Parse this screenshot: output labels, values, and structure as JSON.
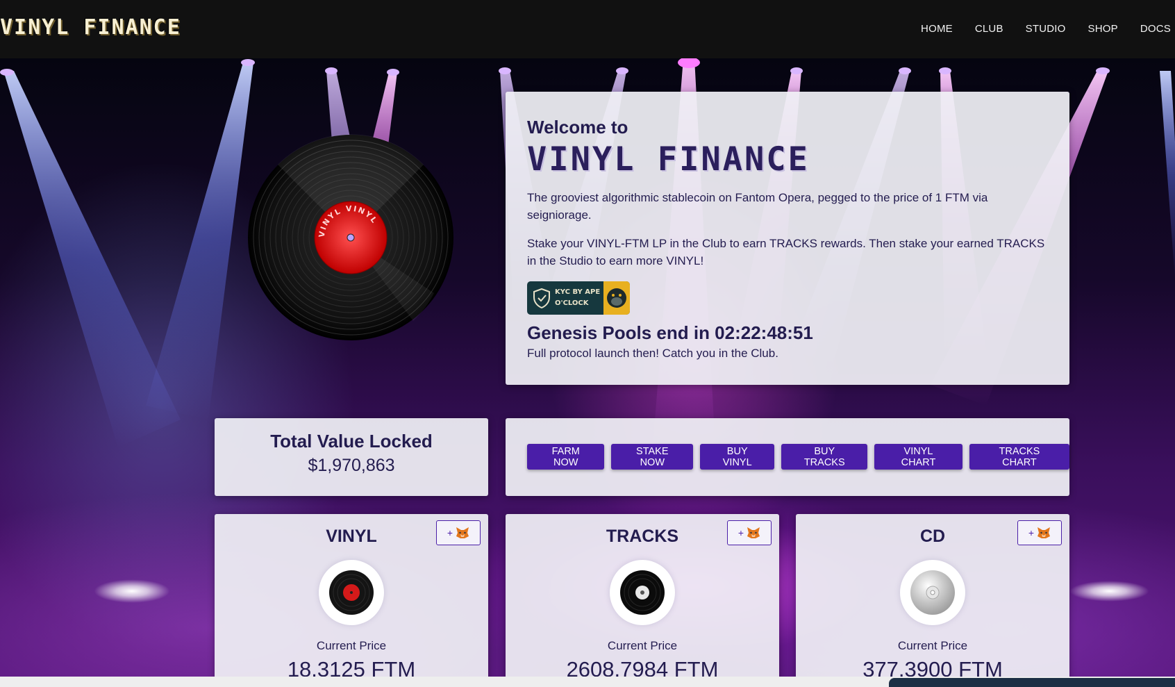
{
  "header": {
    "logo": "VINYL FINANCE",
    "nav": [
      "HOME",
      "CLUB",
      "STUDIO",
      "SHOP",
      "DOCS"
    ]
  },
  "record": {
    "label_text": "VINYL VINYL"
  },
  "welcome": {
    "pre_title": "Welcome to",
    "title": "VINYL FINANCE",
    "paragraph1": "The grooviest algorithmic stablecoin on Fantom Opera, pegged to the price of 1 FTM via seigniorage.",
    "paragraph2": "Stake your VINYL-FTM LP in the Club to earn TRACKS rewards. Then stake your earned TRACKS in the Studio to earn more VINYL!",
    "kyc_badge": "KYC BY APE O'CLOCK",
    "genesis": "Genesis Pools end in 02:22:48:51",
    "launch_note": "Full protocol launch then! Catch you in the Club."
  },
  "tvl": {
    "label": "Total Value Locked",
    "value": "$1,970,863"
  },
  "actions": [
    "FARM NOW",
    "STAKE NOW",
    "BUY VINYL",
    "BUY TRACKS",
    "VINYL CHART",
    "TRACKS CHART"
  ],
  "tokens": [
    {
      "name": "VINYL",
      "add_label": "+",
      "price_label": "Current Price",
      "price": "18.3125 FTM",
      "icon": "vinyl-record-red-icon"
    },
    {
      "name": "TRACKS",
      "add_label": "+",
      "price_label": "Current Price",
      "price": "2608.7984 FTM",
      "icon": "vinyl-record-black-icon"
    },
    {
      "name": "CD",
      "add_label": "+",
      "price_label": "Current Price",
      "price": "377.3900 FTM",
      "icon": "compact-disc-icon"
    }
  ],
  "colors": {
    "header_bg": "#111111",
    "button_bg": "#4a1ea8",
    "text_dark": "#231c4f",
    "card_bg": "#f0f0f5"
  }
}
